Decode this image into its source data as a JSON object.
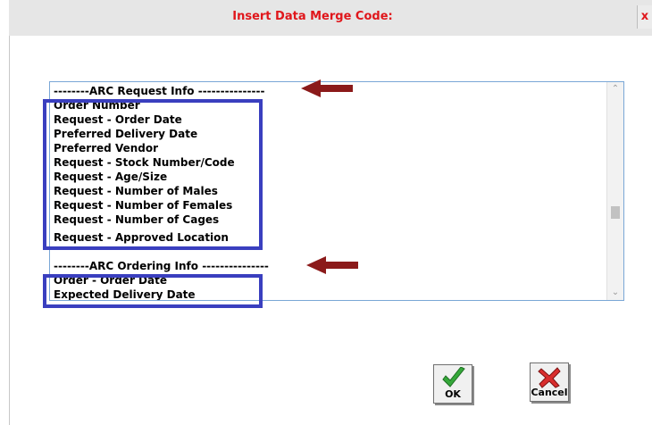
{
  "dialog": {
    "title": "Insert Data Merge Code:",
    "close_label": "x"
  },
  "list": {
    "rows": [
      "--------ARC Request Info ---------------",
      "Order Number",
      "Request - Order Date",
      "Preferred Delivery Date",
      "Preferred Vendor",
      "Request - Stock Number/Code",
      "Request - Age/Size",
      "Request - Number of Males",
      "Request - Number of Females",
      "Request - Number of Cages",
      "Request - Approved Location",
      "",
      "--------ARC Ordering Info ---------------",
      "Order - Order Date",
      "Expected Delivery Date"
    ]
  },
  "buttons": {
    "ok_label": "OK",
    "cancel_label": "Cancel"
  },
  "colors": {
    "title": "#e0161b",
    "highlight_box": "#3a3fbf",
    "arrow": "#8b1a1a"
  }
}
